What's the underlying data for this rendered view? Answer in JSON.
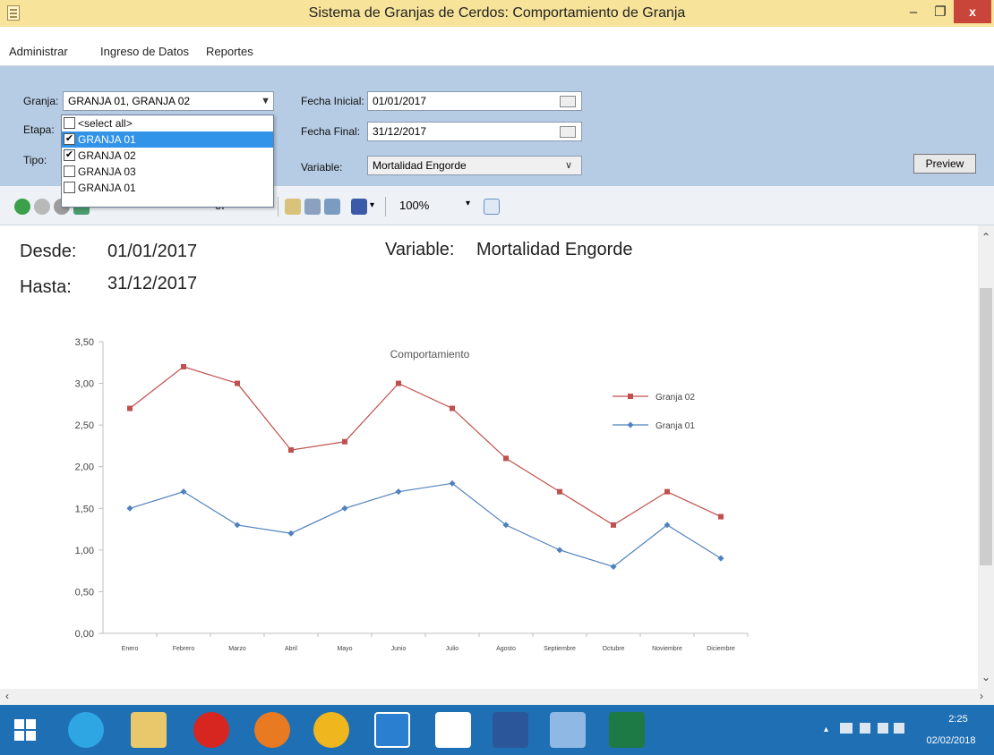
{
  "window": {
    "title": "Sistema de Granjas de Cerdos: Comportamiento de Granja",
    "minimize": "–",
    "maximize": "❐",
    "close": "x"
  },
  "menu": [
    "Administrar",
    "Ingreso de Datos",
    "Reportes"
  ],
  "filters": {
    "granja_label": "Granja:",
    "granja_value": "GRANJA 01, GRANJA 02",
    "etapa_label": "Etapa:",
    "tipo_label": "Tipo:",
    "fecha_inicial_label": "Fecha Inicial:",
    "fecha_inicial_value": "01/01/2017",
    "fecha_final_label": "Fecha Final:",
    "fecha_final_value": "31/12/2017",
    "variable_label": "Variable:",
    "variable_value": "Mortalidad Engorde",
    "preview_label": "Preview"
  },
  "granja_dropdown": {
    "options": [
      {
        "label": "<select all>",
        "checked": false,
        "highlighted": false
      },
      {
        "label": "GRANJA 01",
        "checked": true,
        "highlighted": true
      },
      {
        "label": "GRANJA 02",
        "checked": true,
        "highlighted": false
      },
      {
        "label": "GRANJA 03",
        "checked": false,
        "highlighted": false
      },
      {
        "label": "GRANJA 01",
        "checked": false,
        "highlighted": false
      }
    ]
  },
  "toolbar": {
    "zoom": "100%",
    "page_of": "of"
  },
  "report": {
    "desde_label": "Desde:",
    "desde_value": "01/01/2017",
    "hasta_label": "Hasta:",
    "hasta_value": "31/12/2017",
    "variable_label": "Variable:",
    "variable_value": "Mortalidad Engorde"
  },
  "chart_data": {
    "type": "line",
    "title": "Comportamiento",
    "xlabel": "",
    "ylabel": "",
    "categories": [
      "Enero",
      "Febrero",
      "Marzo",
      "Abril",
      "Mayo",
      "Junio",
      "Julio",
      "Agosto",
      "Septiembre",
      "Octubre",
      "Noviembre",
      "Diciembre"
    ],
    "series": [
      {
        "name": "Granja 02",
        "color": "#c0504d",
        "marker": "square",
        "values": [
          2.7,
          3.2,
          3.0,
          2.2,
          2.3,
          3.0,
          2.7,
          2.1,
          1.7,
          1.3,
          1.7,
          1.4
        ]
      },
      {
        "name": "Granja 01",
        "color": "#4f81bd",
        "marker": "diamond",
        "values": [
          1.5,
          1.7,
          1.3,
          1.2,
          1.5,
          1.7,
          1.8,
          1.3,
          1.0,
          0.8,
          1.3,
          0.9
        ]
      }
    ],
    "yticks": [
      "0,00",
      "0,50",
      "1,00",
      "1,50",
      "2,00",
      "2,50",
      "3,00",
      "3,50"
    ],
    "ylim": [
      0,
      3.5
    ],
    "grid": false,
    "legend_position": "right"
  },
  "taskbar": {
    "time": "2:25",
    "date": "02/02/2018"
  }
}
